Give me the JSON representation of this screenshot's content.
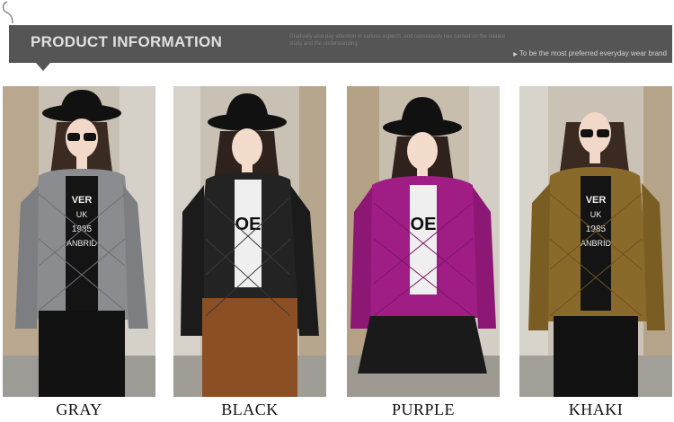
{
  "banner": {
    "title": "PRODUCT INFORMATION",
    "subtitle": "Gradually also pay attention in various aspects, and consciously has carried on the related study and the understanding",
    "tagline": "To be the most preferred everyday wear brand"
  },
  "products": [
    {
      "color_label": "GRAY",
      "jacket_color": "#8a8c8f",
      "shirt_text": [
        "VER",
        "UK",
        "1985",
        "ANBRID"
      ]
    },
    {
      "color_label": "BLACK",
      "jacket_color": "#232323",
      "shirt_text": [
        "OE"
      ]
    },
    {
      "color_label": "PURPLE",
      "jacket_color": "#a01d86",
      "shirt_text": [
        "OE"
      ]
    },
    {
      "color_label": "KHAKI",
      "jacket_color": "#8a6a2a",
      "shirt_text": [
        "VER",
        "UK",
        "1985",
        "ANBRID"
      ]
    }
  ]
}
